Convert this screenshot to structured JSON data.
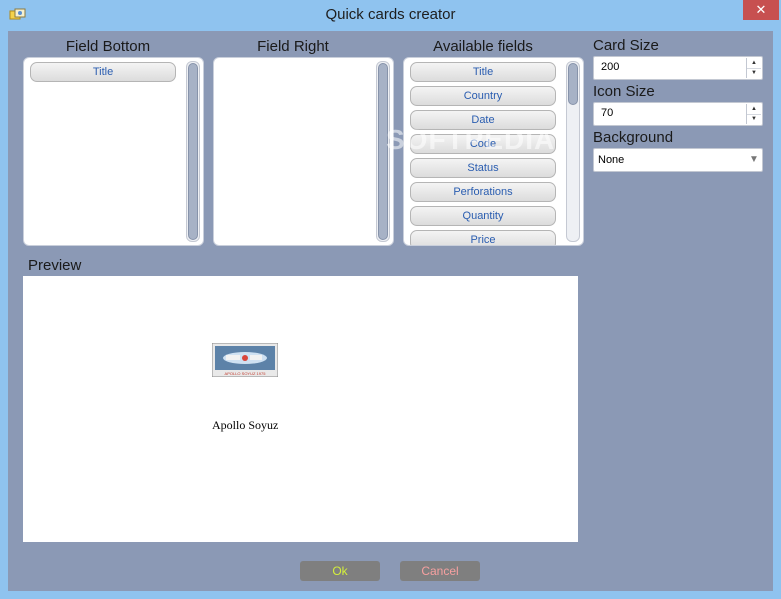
{
  "window": {
    "title": "Quick cards creator",
    "close_glyph": "✕",
    "app_icon": "cards-app-icon"
  },
  "field_bottom": {
    "label": "Field Bottom",
    "items": [
      "Title"
    ]
  },
  "field_right": {
    "label": "Field Right",
    "items": []
  },
  "available_fields": {
    "label": "Available fields",
    "items": [
      "Title",
      "Country",
      "Date",
      "Code",
      "Status",
      "Perforations",
      "Quantity",
      "Price"
    ]
  },
  "card_size": {
    "label": "Card Size",
    "value": "200"
  },
  "icon_size": {
    "label": "Icon Size",
    "value": "70"
  },
  "background": {
    "label": "Background",
    "value": "None"
  },
  "preview": {
    "label": "Preview",
    "caption": "Apollo Soyuz",
    "stamp_text": "APOLLO SOYUZ 1975"
  },
  "buttons": {
    "ok": "Ok",
    "cancel": "Cancel"
  },
  "watermark": "SOFTPEDIA",
  "colors": {
    "titlebar": "#8fc3ef",
    "client": "#8b99b5",
    "pill_text": "#2a5db0",
    "ok_text": "#d4ef3c",
    "cancel_text": "#f6a0a0",
    "close": "#c75050"
  }
}
